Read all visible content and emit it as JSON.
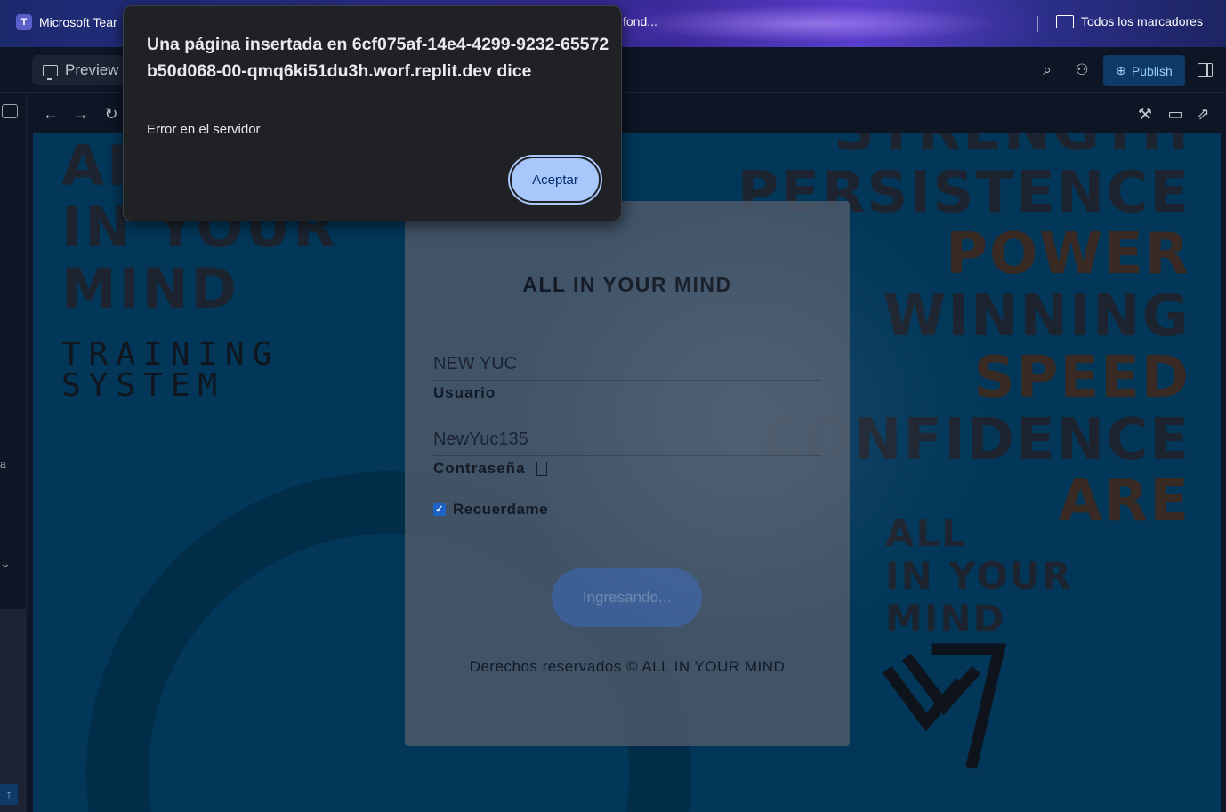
{
  "bookmarks": {
    "teams_label": "Microsoft Tear",
    "fondo_label": "fond...",
    "all_bookmarks_label": "Todos los marcadores"
  },
  "toolbar": {
    "preview_label": "Preview",
    "publish_label": "Publish"
  },
  "poster": {
    "left_lines": [
      "AI",
      "IN YOUR",
      "MIND"
    ],
    "left_sub_lines": [
      "TRAINING",
      "SYSTEM"
    ],
    "right_words": [
      "STRENGTH",
      "PERSISTENCE",
      "POWER",
      "WINNING",
      "SPEED",
      "CONFIDENCE",
      "ARE"
    ],
    "right_tag": [
      "ALL",
      "IN YOUR",
      "MIND"
    ]
  },
  "login": {
    "title": "ALL IN YOUR MIND",
    "username_value": "NEW YUC",
    "username_label": "Usuario",
    "password_value": "NewYuc135",
    "password_label": "Contraseña",
    "remember_label": "Recuerdame",
    "remember_checked": true,
    "submit_label": "Ingresando...",
    "footer": "Derechos reservados © ALL IN YOUR MIND"
  },
  "alert": {
    "title": "Una página insertada en 6cf075af-14e4-4299-9232-65572b50d068-00-qmq6ki51du3h.worf.replit.dev dice",
    "message": "Error en el servidor",
    "ok_label": "Aceptar"
  },
  "colors": {
    "viewport_bg": "#02375a",
    "card_bg": "#465668",
    "publish_bg": "#0d3a66",
    "alert_button": "#a8c7fa"
  }
}
